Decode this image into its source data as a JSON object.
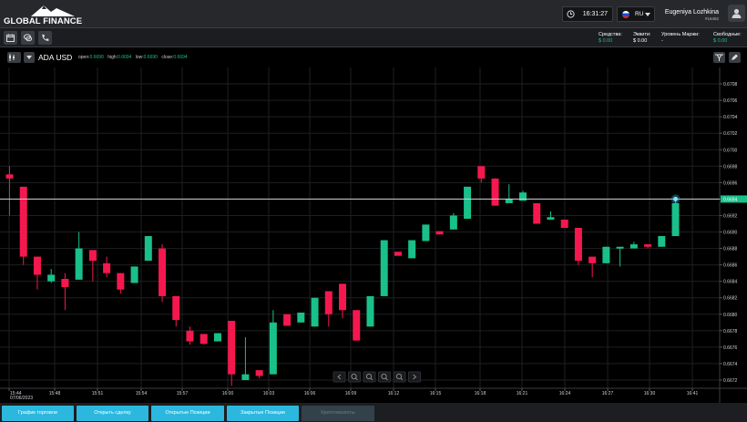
{
  "header": {
    "logo_text": "GLOBAL FINANCE",
    "time": "16:31:27",
    "language": "RU",
    "user_name": "Eugeniya Lozhkina",
    "user_id": "#16462"
  },
  "account": {
    "funds_label": "Средства:",
    "funds_value": "$ 0.00",
    "equity_label": "Эквити:",
    "equity_value": "$ 0.00",
    "margin_level_label": "Уровень Маржи:",
    "margin_level_value": "-",
    "free_label": "Свободные:",
    "free_value": "$ 0.00"
  },
  "chart_header": {
    "symbol": "ADA USD",
    "open_label": "open:",
    "open_value": "0.6690",
    "high_label": "high:",
    "high_value": "0.6694",
    "low_label": "low:",
    "low_value": "0.6690",
    "close_label": "close:",
    "close_value": "0.6694"
  },
  "colors": {
    "up": "#19c08a",
    "down": "#f5184f",
    "accent": "#2cb8de",
    "price_tag": "#19c08a"
  },
  "chart_data": {
    "type": "candlestick",
    "current_price": 0.6694,
    "ylim": [
      0.6671,
      0.671
    ],
    "y_ticks": [
      "0.6708",
      "0.6706",
      "0.6704",
      "0.6702",
      "0.6700",
      "0.6698",
      "0.6696",
      "0.6694",
      "0.6692",
      "0.6690",
      "0.6688",
      "0.6686",
      "0.6684",
      "0.6682",
      "0.6680",
      "0.6678",
      "0.6676",
      "0.6674",
      "0.6672"
    ],
    "x_ticks": [
      "15:44\n07/06/2023",
      "15:48",
      "15:51",
      "15:54",
      "15:57",
      "16:00",
      "16:03",
      "16:06",
      "16:09",
      "16:12",
      "16:15",
      "16:18",
      "16:21",
      "16:24",
      "16:27",
      "16:30",
      "16:41"
    ],
    "candles": [
      {
        "o": 0.6697,
        "h": 0.6698,
        "l": 0.6692,
        "c": 0.66965
      },
      {
        "o": 0.66955,
        "h": 0.66955,
        "l": 0.6686,
        "c": 0.6687
      },
      {
        "o": 0.6687,
        "h": 0.6687,
        "l": 0.6683,
        "c": 0.66848
      },
      {
        "o": 0.6684,
        "h": 0.66855,
        "l": 0.66838,
        "c": 0.66848
      },
      {
        "o": 0.66843,
        "h": 0.6685,
        "l": 0.66805,
        "c": 0.66833
      },
      {
        "o": 0.66842,
        "h": 0.669,
        "l": 0.66842,
        "c": 0.6688
      },
      {
        "o": 0.66878,
        "h": 0.66878,
        "l": 0.6684,
        "c": 0.66865
      },
      {
        "o": 0.66862,
        "h": 0.6687,
        "l": 0.66845,
        "c": 0.6685
      },
      {
        "o": 0.6685,
        "h": 0.6685,
        "l": 0.66825,
        "c": 0.6683
      },
      {
        "o": 0.66838,
        "h": 0.66858,
        "l": 0.66838,
        "c": 0.66858
      },
      {
        "o": 0.66865,
        "h": 0.66895,
        "l": 0.66865,
        "c": 0.66895
      },
      {
        "o": 0.6688,
        "h": 0.66885,
        "l": 0.66815,
        "c": 0.66822
      },
      {
        "o": 0.66822,
        "h": 0.66822,
        "l": 0.66785,
        "c": 0.66793
      },
      {
        "o": 0.6678,
        "h": 0.66785,
        "l": 0.66763,
        "c": 0.66767
      },
      {
        "o": 0.66776,
        "h": 0.66776,
        "l": 0.66763,
        "c": 0.66764
      },
      {
        "o": 0.66767,
        "h": 0.66777,
        "l": 0.66767,
        "c": 0.66777
      },
      {
        "o": 0.66792,
        "h": 0.66792,
        "l": 0.66713,
        "c": 0.66727
      },
      {
        "o": 0.6672,
        "h": 0.66772,
        "l": 0.6672,
        "c": 0.66727
      },
      {
        "o": 0.66732,
        "h": 0.66732,
        "l": 0.66722,
        "c": 0.66725
      },
      {
        "o": 0.66727,
        "h": 0.66805,
        "l": 0.66727,
        "c": 0.6679
      },
      {
        "o": 0.668,
        "h": 0.668,
        "l": 0.66786,
        "c": 0.66786
      },
      {
        "o": 0.6679,
        "h": 0.66802,
        "l": 0.6679,
        "c": 0.66802
      },
      {
        "o": 0.66785,
        "h": 0.6682,
        "l": 0.66785,
        "c": 0.6682
      },
      {
        "o": 0.66828,
        "h": 0.66828,
        "l": 0.66785,
        "c": 0.668
      },
      {
        "o": 0.66837,
        "h": 0.66837,
        "l": 0.66795,
        "c": 0.66805
      },
      {
        "o": 0.66805,
        "h": 0.66805,
        "l": 0.66768,
        "c": 0.66768
      },
      {
        "o": 0.66785,
        "h": 0.66822,
        "l": 0.66785,
        "c": 0.66822
      },
      {
        "o": 0.66822,
        "h": 0.6689,
        "l": 0.66822,
        "c": 0.6689
      },
      {
        "o": 0.66876,
        "h": 0.66876,
        "l": 0.66876,
        "c": 0.66871
      },
      {
        "o": 0.66868,
        "h": 0.6689,
        "l": 0.66868,
        "c": 0.6689
      },
      {
        "o": 0.66889,
        "h": 0.66909,
        "l": 0.66889,
        "c": 0.66909
      },
      {
        "o": 0.66901,
        "h": 0.66901,
        "l": 0.66897,
        "c": 0.66897
      },
      {
        "o": 0.66903,
        "h": 0.66923,
        "l": 0.66903,
        "c": 0.6692
      },
      {
        "o": 0.66916,
        "h": 0.66955,
        "l": 0.66916,
        "c": 0.66955
      },
      {
        "o": 0.6698,
        "h": 0.6698,
        "l": 0.6696,
        "c": 0.66965
      },
      {
        "o": 0.66965,
        "h": 0.66965,
        "l": 0.66932,
        "c": 0.66932
      },
      {
        "o": 0.66935,
        "h": 0.66958,
        "l": 0.66935,
        "c": 0.6694
      },
      {
        "o": 0.66938,
        "h": 0.6695,
        "l": 0.66938,
        "c": 0.66948
      },
      {
        "o": 0.66935,
        "h": 0.66935,
        "l": 0.6691,
        "c": 0.6691
      },
      {
        "o": 0.66915,
        "h": 0.66925,
        "l": 0.66915,
        "c": 0.66918
      },
      {
        "o": 0.66915,
        "h": 0.66915,
        "l": 0.66905,
        "c": 0.66905
      },
      {
        "o": 0.66905,
        "h": 0.66905,
        "l": 0.6686,
        "c": 0.66865
      },
      {
        "o": 0.6687,
        "h": 0.6687,
        "l": 0.66845,
        "c": 0.66862
      },
      {
        "o": 0.66862,
        "h": 0.66882,
        "l": 0.66862,
        "c": 0.66882
      },
      {
        "o": 0.66882,
        "h": 0.66882,
        "l": 0.66858,
        "c": 0.66882
      },
      {
        "o": 0.6688,
        "h": 0.66888,
        "l": 0.6688,
        "c": 0.66885
      },
      {
        "o": 0.66885,
        "h": 0.66885,
        "l": 0.6688,
        "c": 0.66882
      },
      {
        "o": 0.66882,
        "h": 0.66895,
        "l": 0.66882,
        "c": 0.66895
      },
      {
        "o": 0.66895,
        "h": 0.66938,
        "l": 0.66895,
        "c": 0.66935
      }
    ]
  },
  "bottom": {
    "btn_chart": "График торговли",
    "btn_open_trade": "Открыть сделку",
    "btn_open_positions": "Открытые Позиции",
    "btn_closed_positions": "Закрытые Позиции",
    "btn_crypto": "Криптовалюты"
  }
}
